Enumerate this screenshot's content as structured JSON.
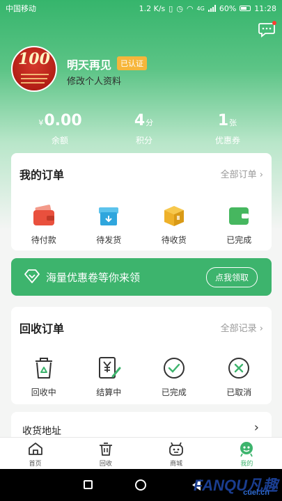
{
  "status_bar": {
    "carrier": "中国移动",
    "speed": "1.2 K/s",
    "network": "4G",
    "battery": "60%",
    "time": "11:28"
  },
  "profile": {
    "name": "明天再见",
    "verified_badge": "已认证",
    "edit_label": "修改个人资料",
    "avatar_number": "100"
  },
  "stats": [
    {
      "prefix": "¥",
      "value": "0.00",
      "unit": "",
      "label": "余额"
    },
    {
      "prefix": "",
      "value": "4",
      "unit": "分",
      "label": "积分"
    },
    {
      "prefix": "",
      "value": "1",
      "unit": "张",
      "label": "优惠券"
    }
  ],
  "orders": {
    "title": "我的订单",
    "link": "全部订单",
    "items": [
      {
        "label": "待付款",
        "icon": "wallet-icon"
      },
      {
        "label": "待发货",
        "icon": "package-icon"
      },
      {
        "label": "待收货",
        "icon": "box-icon"
      },
      {
        "label": "已完成",
        "icon": "completed-wallet-icon"
      }
    ]
  },
  "promo": {
    "text": "海量优惠卷等你来领",
    "button": "点我领取"
  },
  "recycle": {
    "title": "回收订单",
    "link": "全部记录",
    "items": [
      {
        "label": "回收中",
        "icon": "recycle-bin-icon"
      },
      {
        "label": "结算中",
        "icon": "yen-edit-icon"
      },
      {
        "label": "已完成",
        "icon": "check-circle-icon"
      },
      {
        "label": "已取消",
        "icon": "cancel-circle-icon"
      }
    ]
  },
  "address": {
    "label": "收货地址"
  },
  "tabbar": [
    {
      "label": "首页",
      "icon": "home-icon"
    },
    {
      "label": "回收",
      "icon": "basket-icon"
    },
    {
      "label": "商城",
      "icon": "robot-icon"
    },
    {
      "label": "我的",
      "icon": "profile-face-icon",
      "active": true
    }
  ],
  "watermark": {
    "main": "FANQU凡趣",
    "sub": "cuel.cn"
  },
  "colors": {
    "brand": "#3db46d",
    "badge": "#f6b63b",
    "notify": "#ff3b30"
  }
}
